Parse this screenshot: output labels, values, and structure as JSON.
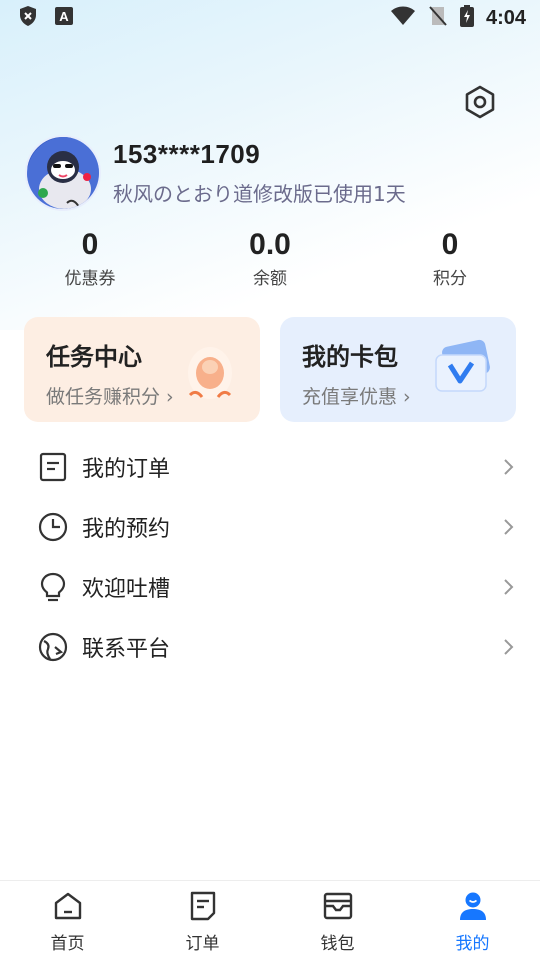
{
  "status_bar": {
    "time": "4:04"
  },
  "profile": {
    "phone": "153****1709",
    "motto": "秋风のとおり道修改版已使用1天"
  },
  "stats": [
    {
      "value": "0",
      "label": "优惠券"
    },
    {
      "value": "0.0",
      "label": "余额"
    },
    {
      "value": "0",
      "label": "积分"
    }
  ],
  "cards": {
    "task": {
      "title": "任务中心",
      "subtitle": "做任务赚积分 ›"
    },
    "wallet": {
      "title": "我的卡包",
      "subtitle": "充值享优惠 ›"
    }
  },
  "menu": [
    {
      "label": "我的订单",
      "icon": "order-icon"
    },
    {
      "label": "我的预约",
      "icon": "clock-icon"
    },
    {
      "label": "欢迎吐槽",
      "icon": "lightbulb-icon"
    },
    {
      "label": "联系平台",
      "icon": "contact-icon"
    }
  ],
  "tabbar": [
    {
      "label": "首页",
      "icon": "home-icon"
    },
    {
      "label": "订单",
      "icon": "order-tab-icon"
    },
    {
      "label": "钱包",
      "icon": "wallet-icon"
    },
    {
      "label": "我的",
      "icon": "user-icon",
      "active": true
    }
  ],
  "colors": {
    "accent": "#1677ff",
    "task_card_bg": "#fdeee3",
    "wallet_card_bg": "#e6effd"
  }
}
